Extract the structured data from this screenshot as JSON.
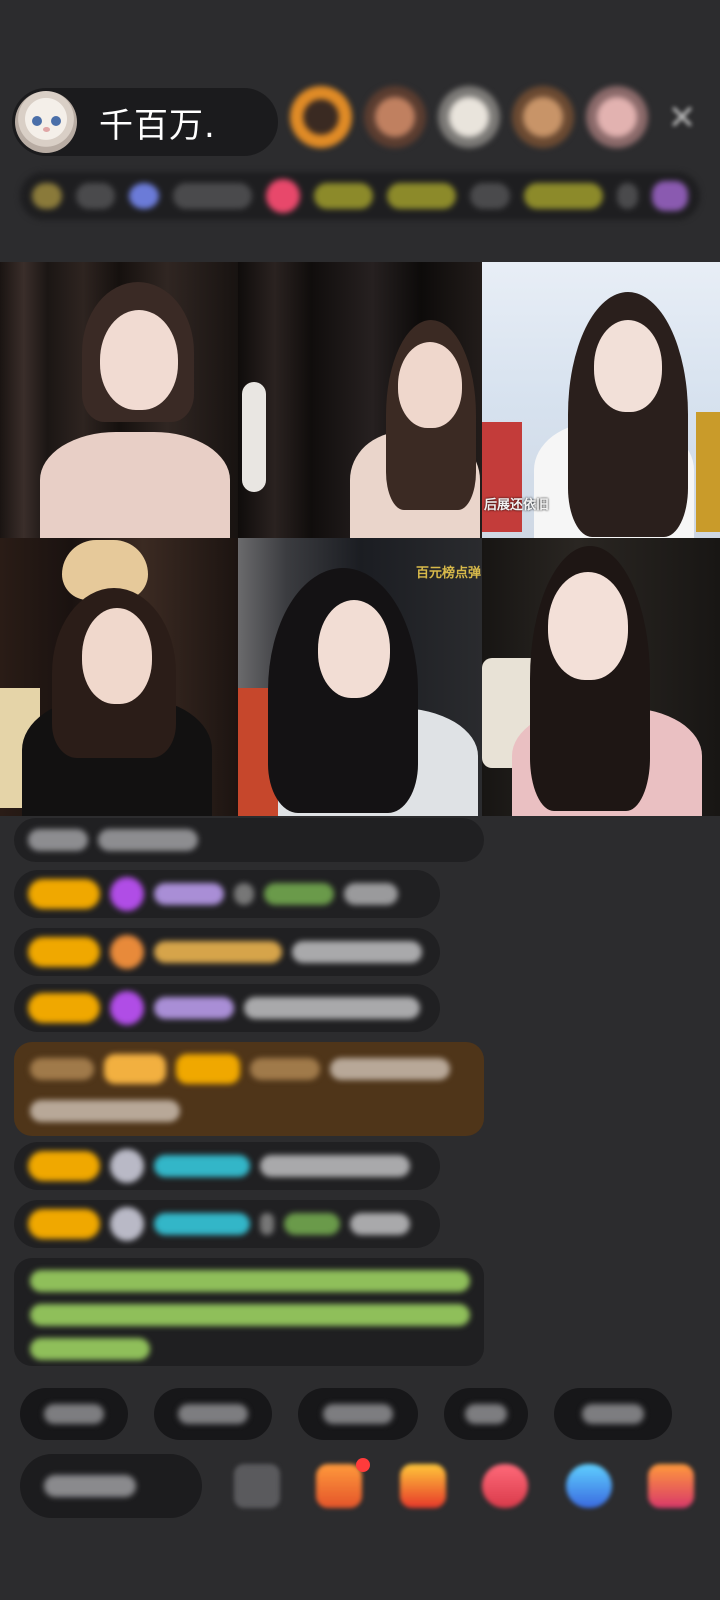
{
  "host": {
    "name": "千百万.",
    "avatar_icon": "cat-avatar-icon"
  },
  "header": {
    "close_icon": "close-icon",
    "viewer_avatars": [
      "#d98a2b",
      "#a36b4f",
      "#c9c2b8",
      "#b07c55",
      "#c28b8b"
    ]
  },
  "grid": {
    "overlays": {
      "cell3": "后展还依旧",
      "cell5": "百元榜点弹"
    }
  },
  "chat": {
    "badge_color": "#f0a800",
    "messages_count_visible": 7
  },
  "colors": {
    "background": "#2c2c2e",
    "badge": "#f0a800",
    "name_purple": "#a98ed6",
    "name_cyan": "#33b6c8",
    "name_gold": "#d6a44a",
    "system_green": "#9bd26a",
    "highlight_brown": "#4f3519"
  },
  "bottom_tools": [
    "emoji-icon",
    "gift-box-icon",
    "gift-icon",
    "heart-gift-icon",
    "blue-gift-icon",
    "more-gift-icon"
  ]
}
